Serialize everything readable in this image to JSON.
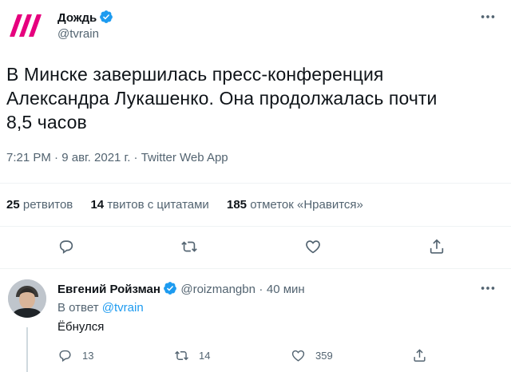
{
  "tweet": {
    "author_name": "Дождь",
    "author_handle": "@tvrain",
    "text_lines": [
      "В Минске завершилась пресс-конференция",
      "Александра Лукашенко. Она продолжалась почти",
      "8,5 часов"
    ],
    "time": "7:21 PM",
    "date": "9 авг. 2021 г.",
    "source": "Twitter Web App",
    "separator": "·",
    "stats": {
      "retweets_count": "25",
      "retweets_label": "ретвитов",
      "quotes_count": "14",
      "quotes_label": "твитов с цитатами",
      "likes_count": "185",
      "likes_label": "отметок «Нравится»"
    },
    "icons": [
      "reply-icon",
      "retweet-icon",
      "like-icon",
      "share-icon"
    ]
  },
  "reply": {
    "author_name": "Евгений Ройзман",
    "author_handle": "@roizmangbn",
    "time_ago": "40 мин",
    "separator": "·",
    "reply_to_prefix": "В ответ",
    "reply_to_handle": "@tvrain",
    "text": "Ёбнулся",
    "counts": {
      "replies": "13",
      "retweets": "14",
      "likes": "359"
    }
  },
  "colors": {
    "accent": "#1d9bf0",
    "brand_tvrain": "#e6007e",
    "secondary_text": "#536471"
  }
}
